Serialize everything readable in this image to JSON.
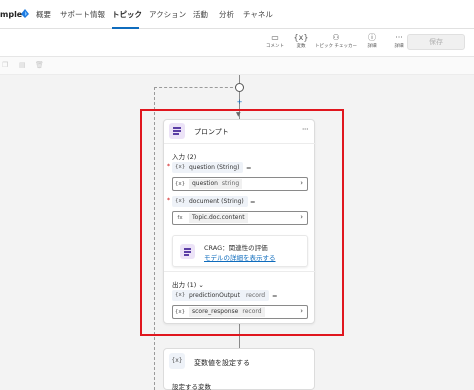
{
  "app": {
    "name": "mple"
  },
  "nav": {
    "tabs": [
      "概要",
      "サポート情報",
      "トピック",
      "アクション",
      "活動",
      "分析",
      "チャネル"
    ],
    "active": "トピック"
  },
  "toolbar": {
    "comment_label": "コメント",
    "comment_icon": "comment-icon",
    "variables_label": "変数",
    "variables_icon": "variable-icon",
    "checker_label": "トピック チェッカー",
    "checker_icon": "checker-icon",
    "details_label": "詳細",
    "details_icon": "info-icon",
    "more_label": "詳細",
    "more_icon": "more-icon",
    "save_label": "保存"
  },
  "prompt_node": {
    "title": "プロンプト",
    "more": "···",
    "inputs_label": "入力 (2)",
    "inputs": [
      {
        "name": "question (String)",
        "required": "*",
        "eq": "=",
        "value": "question",
        "type": "string",
        "kind": "{x}"
      },
      {
        "name": "document (String)",
        "required": "*",
        "eq": "=",
        "value": "Topic.doc.content",
        "type": "",
        "kind": "fx"
      }
    ],
    "info": {
      "title": "CRAG：関連性の評価",
      "link": "モデルの詳細を表示する"
    },
    "outputs_label": "出力 (1)",
    "outputs": [
      {
        "name": "predictionOutput",
        "type": "record",
        "eq": "=",
        "value": "score_response",
        "value_type": "record"
      }
    ]
  },
  "set_variable_node": {
    "title": "変数値を設定する",
    "subtitle": "設定する変数",
    "icon": "{x}"
  },
  "colors": {
    "accent": "#0f6cbd",
    "highlight": "#e0161e",
    "prompt_icon_bg": "#ece3f7"
  }
}
